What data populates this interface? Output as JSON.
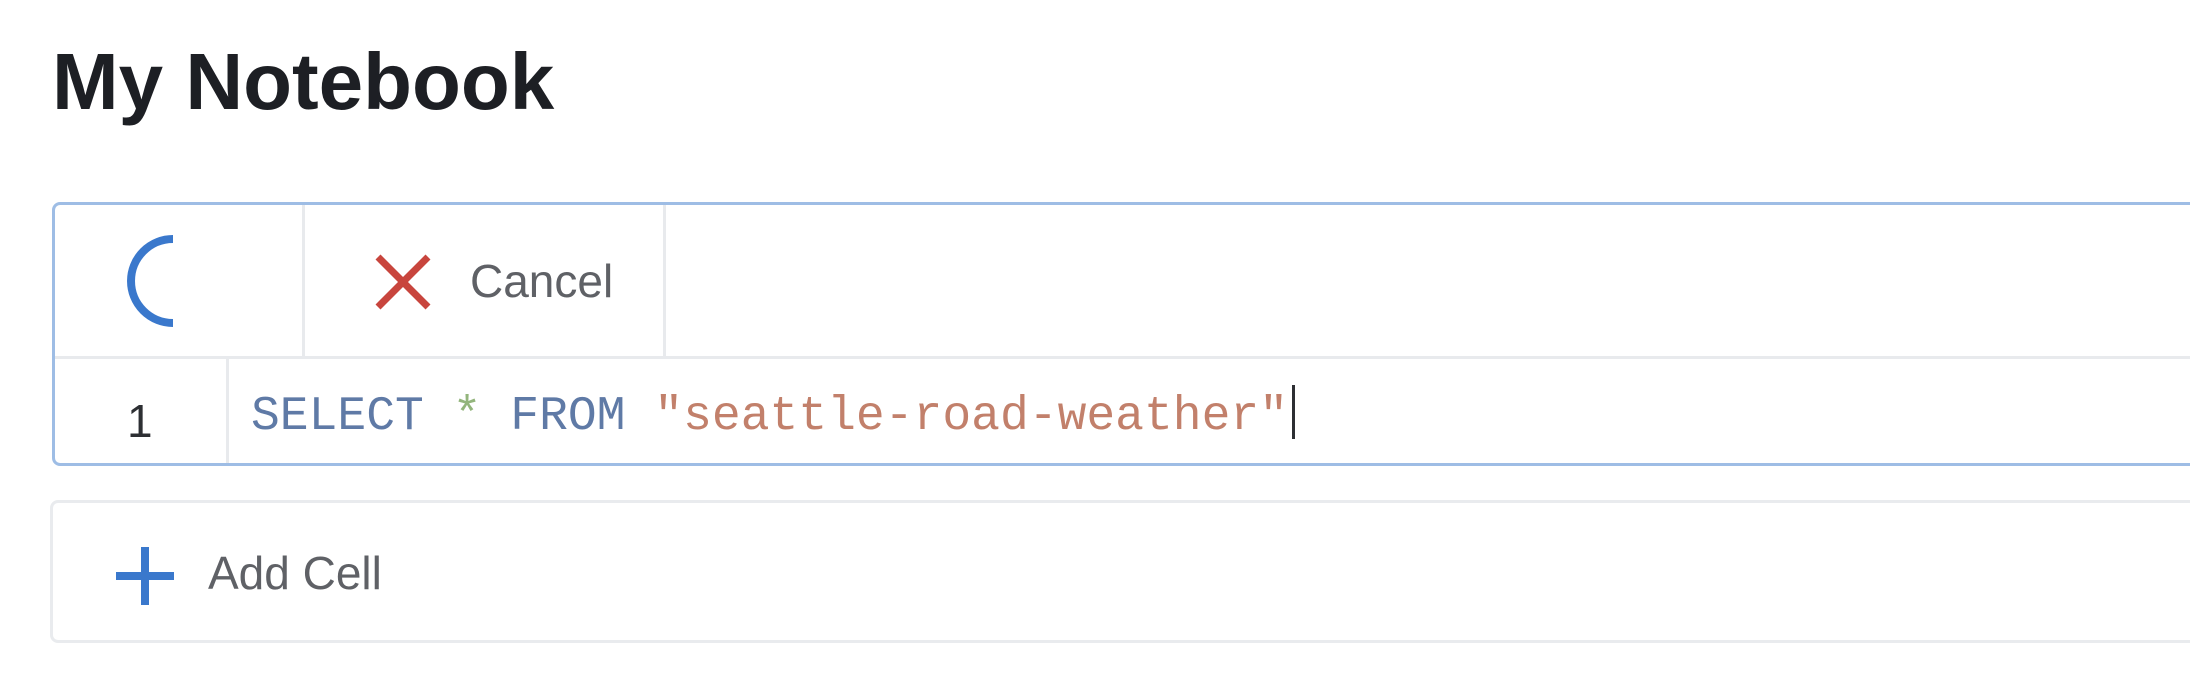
{
  "page": {
    "title": "My Notebook"
  },
  "cell": {
    "status_icon": "loading-spinner-icon",
    "cancel_icon": "close-icon",
    "cancel_label": "Cancel",
    "line_number": "1",
    "code": {
      "keyword_select": "SELECT",
      "operator_star": "*",
      "keyword_from": "FROM",
      "string_table": "\"seattle-road-weather\""
    }
  },
  "add_cell": {
    "icon": "plus-icon",
    "label": "Add Cell"
  },
  "colors": {
    "accent": "#3a78cc",
    "cancel": "#c8453d",
    "keyword": "#5f7aa6",
    "operator": "#93b57c",
    "string": "#c2806b",
    "cell_border_active": "#9ebde5"
  }
}
